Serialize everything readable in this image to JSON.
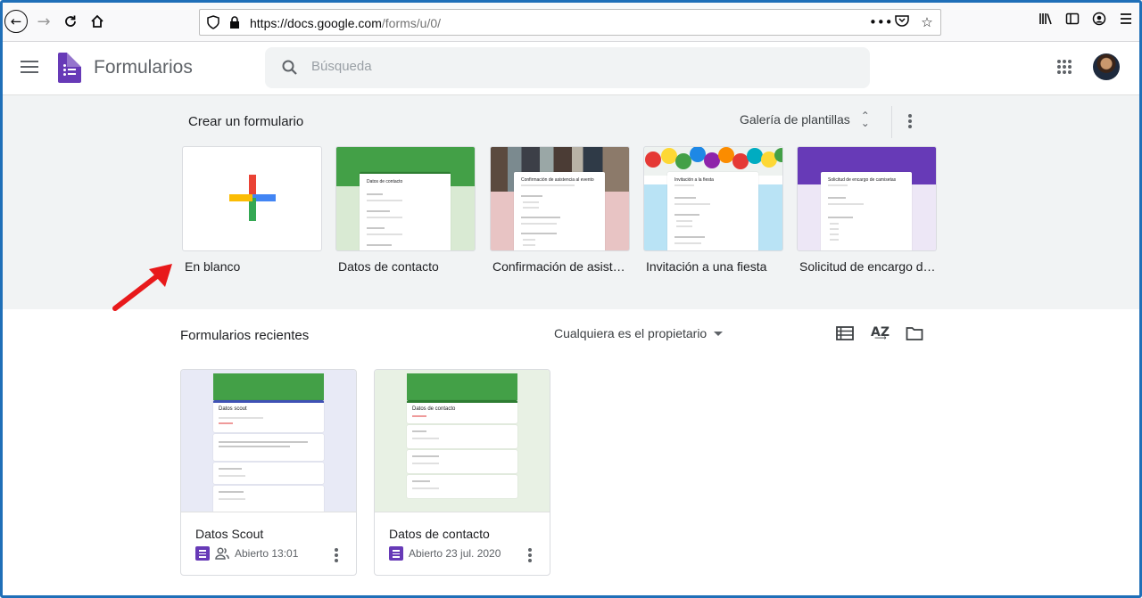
{
  "browser": {
    "url_host": "https://docs.google.com",
    "url_path": "/forms/u/0/"
  },
  "header": {
    "app_title": "Formularios",
    "search_placeholder": "Búsqueda"
  },
  "templates": {
    "section_title": "Crear un formulario",
    "gallery_label": "Galería de plantillas",
    "items": [
      {
        "name": "En blanco"
      },
      {
        "name": "Datos de contacto",
        "preview_title": "Datos de contacto"
      },
      {
        "name": "Confirmación de asistencia al evento",
        "preview_title": "Confirmación de asistencia al evento"
      },
      {
        "name": "Invitación a una fiesta",
        "preview_title": "Invitación a la fiesta"
      },
      {
        "name": "Solicitud de encargo de camisetas",
        "preview_title": "Solicitud de encargo de camisetas"
      }
    ]
  },
  "recent": {
    "section_title": "Formularios recientes",
    "owner_filter": "Cualquiera es el propietario",
    "docs": [
      {
        "name": "Datos Scout",
        "opened": "Abierto 13:01",
        "shared": true,
        "preview_title": "Datos scout"
      },
      {
        "name": "Datos de contacto",
        "opened": "Abierto 23 jul. 2020",
        "shared": false,
        "preview_title": "Datos de contacto"
      }
    ]
  },
  "colors": {
    "forms_purple": "#673ab7",
    "google_green": "#43a047",
    "page_bg": "#f1f3f4",
    "frame_border": "#1f6fb8",
    "annotation_arrow": "#e8191b"
  }
}
